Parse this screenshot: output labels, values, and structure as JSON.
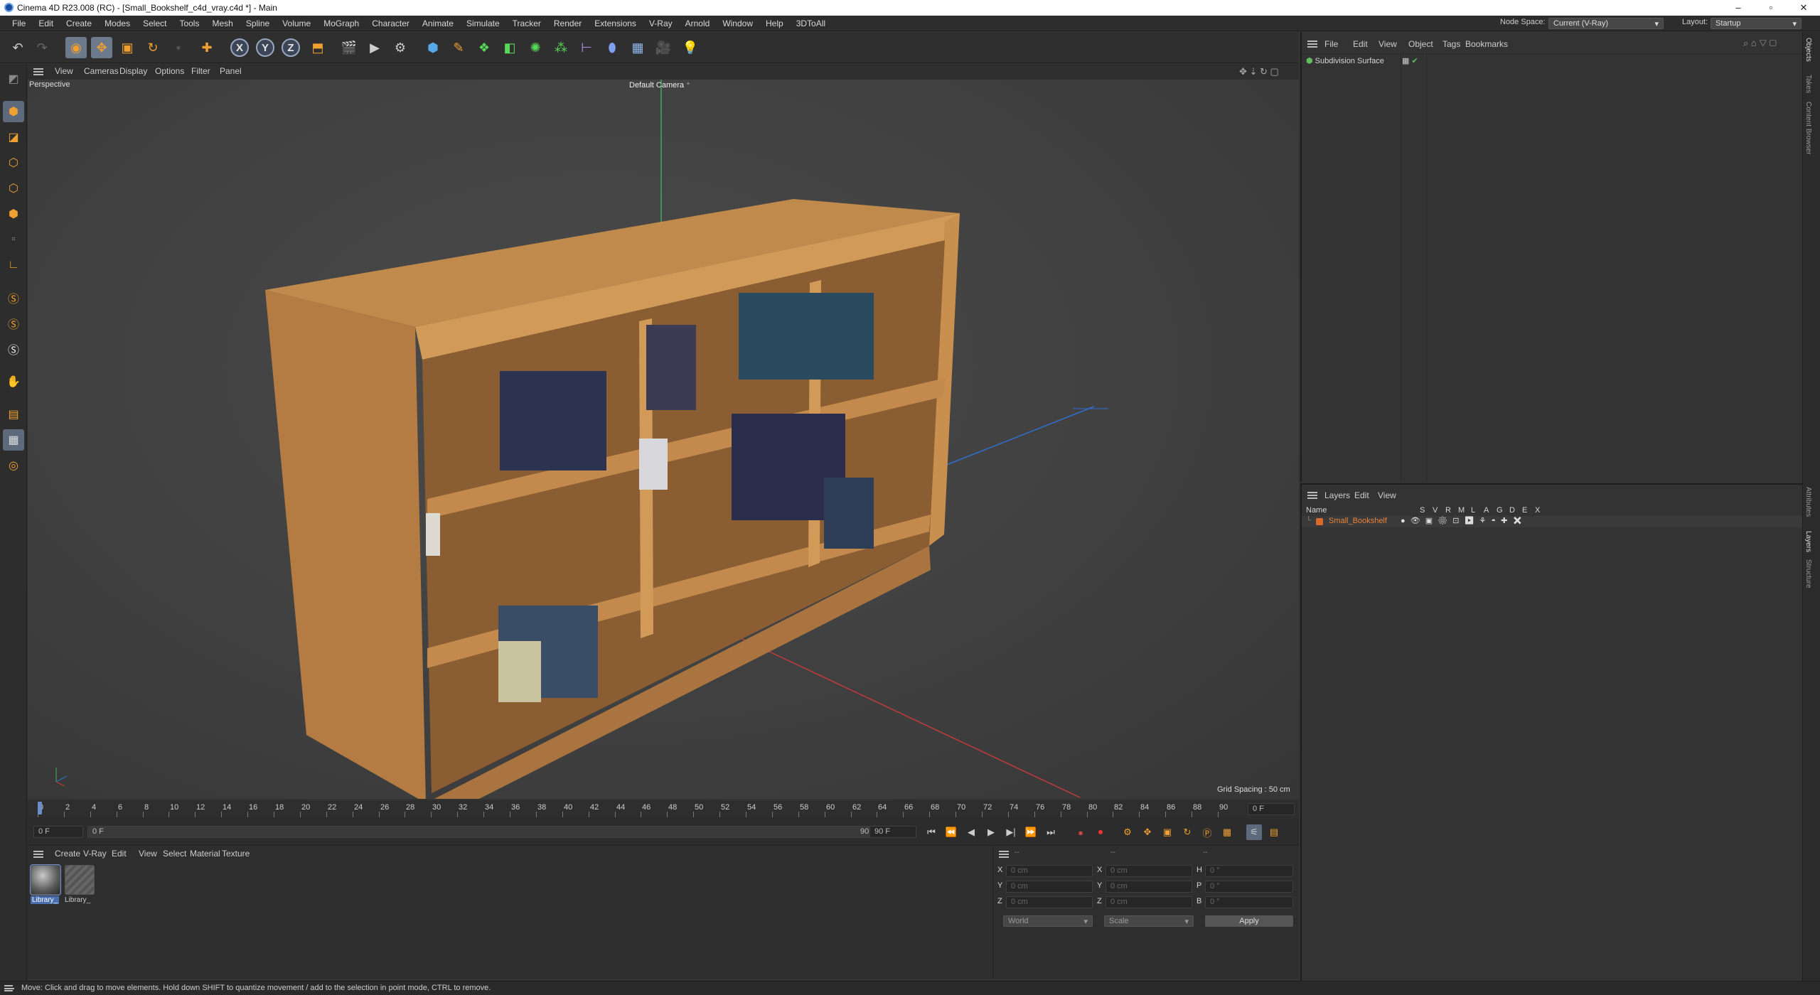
{
  "window": {
    "title": "Cinema 4D R23.008 (RC) - [Small_Bookshelf_c4d_vray.c4d *] - Main",
    "minimize": "–",
    "maximize": "▫",
    "close": "✕"
  },
  "menubar": {
    "items": [
      "File",
      "Edit",
      "Create",
      "Modes",
      "Select",
      "Tools",
      "Mesh",
      "Spline",
      "Volume",
      "MoGraph",
      "Character",
      "Animate",
      "Simulate",
      "Tracker",
      "Render",
      "Extensions",
      "V-Ray",
      "Arnold",
      "Window",
      "Help",
      "3DToAll"
    ],
    "node_space_label": "Node Space:",
    "node_space_value": "Current (V-Ray)",
    "layout_label": "Layout:",
    "layout_value": "Startup"
  },
  "viewport": {
    "menu": [
      "View",
      "Cameras",
      "Display",
      "Options",
      "Filter",
      "Panel"
    ],
    "view_name": "Perspective",
    "camera_name": "Default Camera",
    "grid_spacing": "Grid Spacing : 50 cm"
  },
  "timeline": {
    "ticks": [
      "0",
      "2",
      "4",
      "6",
      "8",
      "10",
      "12",
      "14",
      "16",
      "18",
      "20",
      "22",
      "24",
      "26",
      "28",
      "30",
      "32",
      "34",
      "36",
      "38",
      "40",
      "42",
      "44",
      "46",
      "48",
      "50",
      "52",
      "54",
      "56",
      "58",
      "60",
      "62",
      "64",
      "66",
      "68",
      "70",
      "72",
      "74",
      "76",
      "78",
      "80",
      "82",
      "84",
      "86",
      "88",
      "90"
    ],
    "current_frame_field": "0 F"
  },
  "transport": {
    "start": "0 F",
    "min": "0 F",
    "max": "90 F",
    "end": "90 F"
  },
  "material_manager": {
    "menu": [
      "Create",
      "V-Ray",
      "Edit",
      "View",
      "Select",
      "Material",
      "Texture"
    ],
    "materials": [
      "Library_",
      "Library_"
    ]
  },
  "coordinates": {
    "header_dashes": [
      "--",
      "--",
      "--"
    ],
    "rows": [
      {
        "axis": "X",
        "pos": "0 cm",
        "size": "0 cm",
        "rot_label": "H",
        "rot": "0 °"
      },
      {
        "axis": "Y",
        "pos": "0 cm",
        "size": "0 cm",
        "rot_label": "P",
        "rot": "0 °"
      },
      {
        "axis": "Z",
        "pos": "0 cm",
        "size": "0 cm",
        "rot_label": "B",
        "rot": "0 °"
      }
    ],
    "mode_world": "World",
    "mode_scale": "Scale",
    "apply": "Apply"
  },
  "object_manager": {
    "menu": [
      "File",
      "Edit",
      "View",
      "Object",
      "Tags",
      "Bookmarks"
    ],
    "objects": [
      {
        "name": "Subdivision Surface"
      }
    ]
  },
  "layer_manager": {
    "menu": [
      "Layers",
      "Edit",
      "View"
    ],
    "header_name": "Name",
    "header_flags": [
      "S",
      "V",
      "R",
      "M",
      "L",
      "A",
      "G",
      "D",
      "E",
      "X"
    ],
    "layers": [
      {
        "name": "Small_Bookshelf",
        "color": "#d9682a"
      }
    ]
  },
  "right_tabs": [
    "Objects",
    "Takes",
    "Content Browser",
    "Attributes",
    "Layers",
    "Structure"
  ],
  "status": "Move: Click and drag to move elements. Hold down SHIFT to quantize movement / add to the selection in point mode, CTRL to remove.",
  "colors": {
    "accent": "#6d7a8c",
    "layer_orange": "#d9682a",
    "object_green": "#5fbf5f",
    "wood": "#c8934f"
  }
}
